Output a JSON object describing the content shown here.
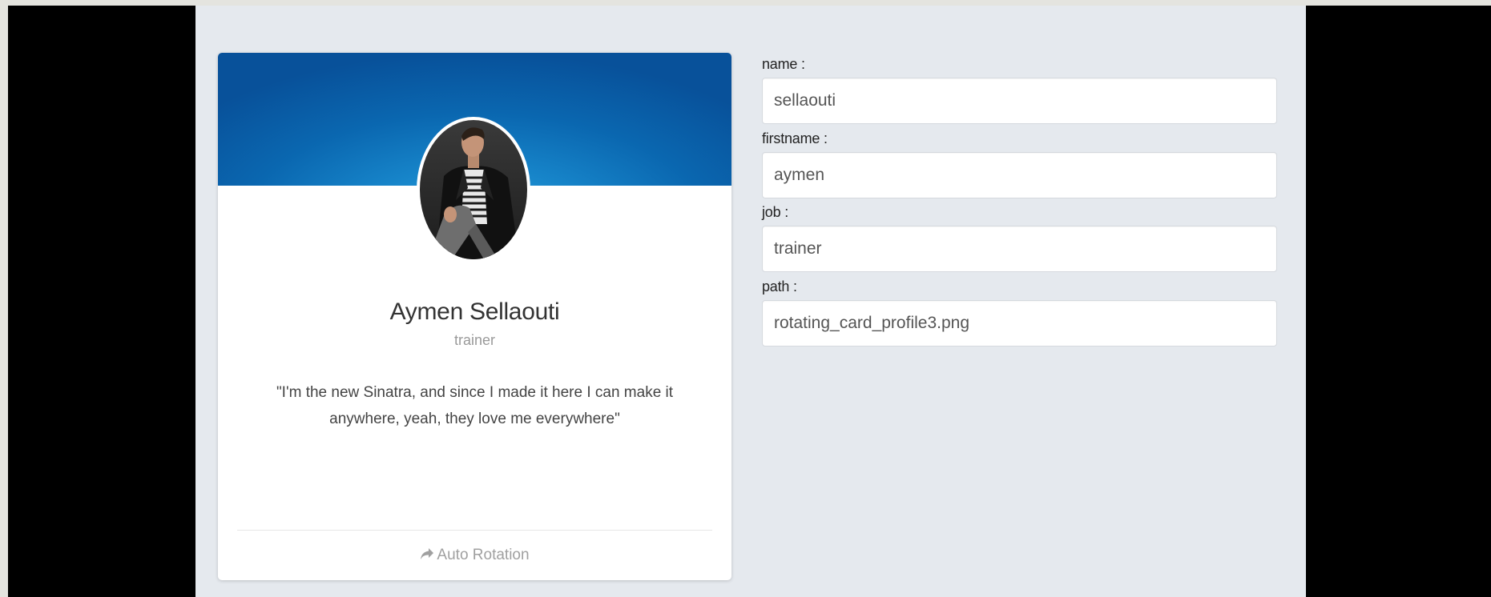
{
  "profile": {
    "name": "Aymen Sellaouti",
    "job": "trainer",
    "quote": "\"I'm the new Sinatra, and since I made it here I can make it anywhere, yeah, they love me everywhere\"",
    "footer_action": "Auto Rotation"
  },
  "form": {
    "name": {
      "label": "name :",
      "value": "sellaouti"
    },
    "firstname": {
      "label": "firstname :",
      "value": "aymen"
    },
    "job": {
      "label": "job :",
      "value": "trainer"
    },
    "path": {
      "label": "path :",
      "value": "rotating_card_profile3.png"
    }
  },
  "colors": {
    "cover_gradient_light": "#2aa3dc",
    "cover_gradient_dark": "#08519a",
    "page_background": "#e5e9ee"
  },
  "icons": {
    "footer": "share-arrow-icon"
  }
}
